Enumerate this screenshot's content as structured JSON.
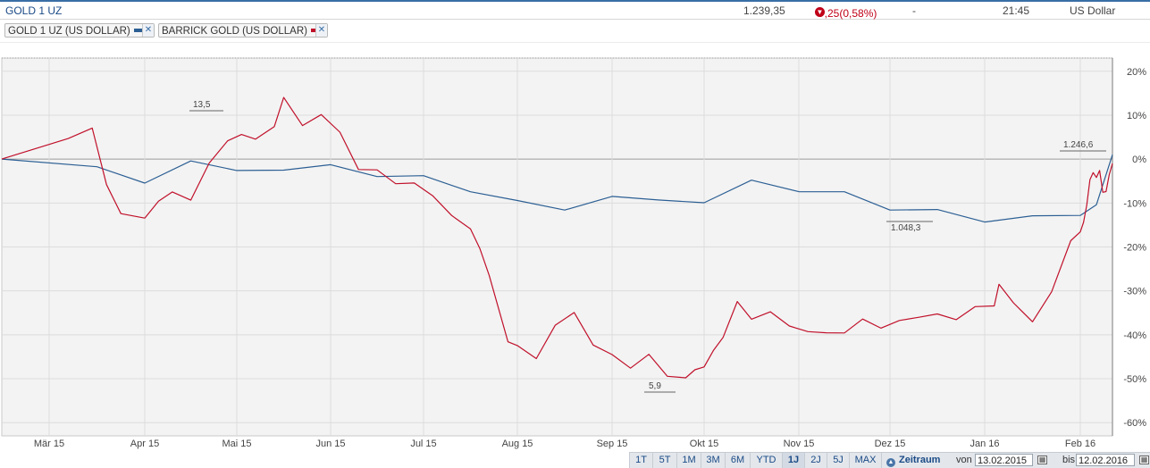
{
  "quote": {
    "name": "GOLD 1 UZ",
    "price": "1.239,35",
    "change": "-7,25(0,58%)",
    "dash": "-",
    "time": "21:45",
    "currency": "US Dollar"
  },
  "legend": [
    {
      "label": "GOLD 1 UZ (US DOLLAR)",
      "color": "#2c5f94"
    },
    {
      "label": "BARRICK GOLD (US DOLLAR)",
      "color": "#c0102a"
    }
  ],
  "ranges": [
    "1T",
    "5T",
    "1M",
    "3M",
    "6M",
    "YTD",
    "1J",
    "2J",
    "5J",
    "MAX"
  ],
  "active_range": "1J",
  "zeitraum": {
    "label": "Zeitraum",
    "von_label": "von",
    "von": "13.02.2015",
    "bis_label": "bis",
    "bis": "12.02.2016"
  },
  "chart_data": {
    "type": "line",
    "title": "",
    "xlabel": "",
    "ylabel": "",
    "x_ticks": [
      "Mär 15",
      "Apr 15",
      "Mai 15",
      "Jun 15",
      "Jul 15",
      "Aug 15",
      "Sep 15",
      "Okt 15",
      "Nov 15",
      "Dez 15",
      "Jan 16",
      "Feb 16"
    ],
    "y_ticks": [
      "20%",
      "10%",
      "0%",
      "-10%",
      "-20%",
      "-30%",
      "-40%",
      "-50%",
      "-60%"
    ],
    "ylim": [
      -63,
      23
    ],
    "grid": true,
    "legend_position": "top-left",
    "annotations": [
      {
        "text": "13,5",
        "x": "Mai 15",
        "series": "BARRICK GOLD (US DOLLAR)"
      },
      {
        "text": "5,9",
        "x": "Okt 15",
        "series": "BARRICK GOLD (US DOLLAR)"
      },
      {
        "text": "1.048,3",
        "x": "Dez 15",
        "series": "GOLD 1 UZ (US DOLLAR)"
      },
      {
        "text": "1.246,6",
        "x": "Feb 16",
        "series": "GOLD 1 UZ (US DOLLAR)"
      }
    ],
    "series": [
      {
        "name": "GOLD 1 UZ (US DOLLAR)",
        "color": "#2c5f94",
        "x_pos": [
          0,
          0.5,
          1,
          1.5,
          2,
          2.5,
          3,
          3.5,
          4,
          4.5,
          5,
          5.5,
          6,
          6.5,
          7,
          7.5,
          8,
          8.5,
          9,
          9.5,
          10,
          10.5,
          11,
          11.5,
          12
        ],
        "values": [
          0,
          -2,
          -5,
          -1,
          -2,
          -3,
          -1,
          -4,
          -4,
          -7,
          -10,
          -11,
          -9,
          -9,
          -10,
          -5,
          -7,
          -8,
          -11,
          -12,
          -14,
          -13,
          -13,
          -10,
          1
        ]
      },
      {
        "name": "BARRICK GOLD (US DOLLAR)",
        "color": "#c0102a",
        "x_pos": [
          0,
          0.2,
          0.45,
          0.6,
          0.75,
          1,
          1.15,
          1.3,
          1.5,
          1.7,
          1.9,
          2.05,
          2.2,
          2.4,
          2.5,
          2.7,
          2.9,
          3.1,
          3.3,
          3.5,
          3.7,
          3.9,
          4.1,
          4.3,
          4.5,
          4.6,
          4.7,
          4.9,
          5,
          5.2,
          5.4,
          5.6,
          5.8,
          6,
          6.2,
          6.4,
          6.6,
          6.8,
          6.9,
          7,
          7.1,
          7.2,
          7.35,
          7.5,
          7.7,
          7.9,
          8.1,
          8.3,
          8.5,
          8.7,
          8.9,
          9.1,
          9.3,
          9.5,
          9.7,
          9.9,
          10.1,
          10.15,
          10.3,
          10.5,
          10.7,
          10.9,
          11,
          11.1,
          11.2,
          11.3,
          11.4,
          11.5,
          11.6,
          11.7,
          11.8,
          11.9,
          12
        ],
        "values": [
          0,
          5,
          7,
          -6,
          -12,
          -14,
          -9,
          -8,
          -9,
          -1,
          4,
          6,
          4,
          8,
          13.5,
          8,
          10,
          6,
          -2,
          -3,
          -5,
          -6,
          -8,
          -13,
          -16,
          -20,
          -27,
          -41,
          -43,
          -45,
          -38,
          -35,
          -42,
          -45,
          -47,
          -45,
          -49,
          -50,
          -48,
          -47,
          -44,
          -40,
          -33,
          -36,
          -35,
          -38,
          -39,
          -40,
          -39,
          -37,
          -38,
          -37,
          -36,
          -35,
          -37,
          -33,
          -34,
          -28,
          -33,
          -37,
          -30,
          -19,
          -16,
          -15,
          -10,
          -5,
          -3,
          -4,
          -3,
          -7,
          -8,
          -3,
          -1
        ]
      }
    ]
  }
}
